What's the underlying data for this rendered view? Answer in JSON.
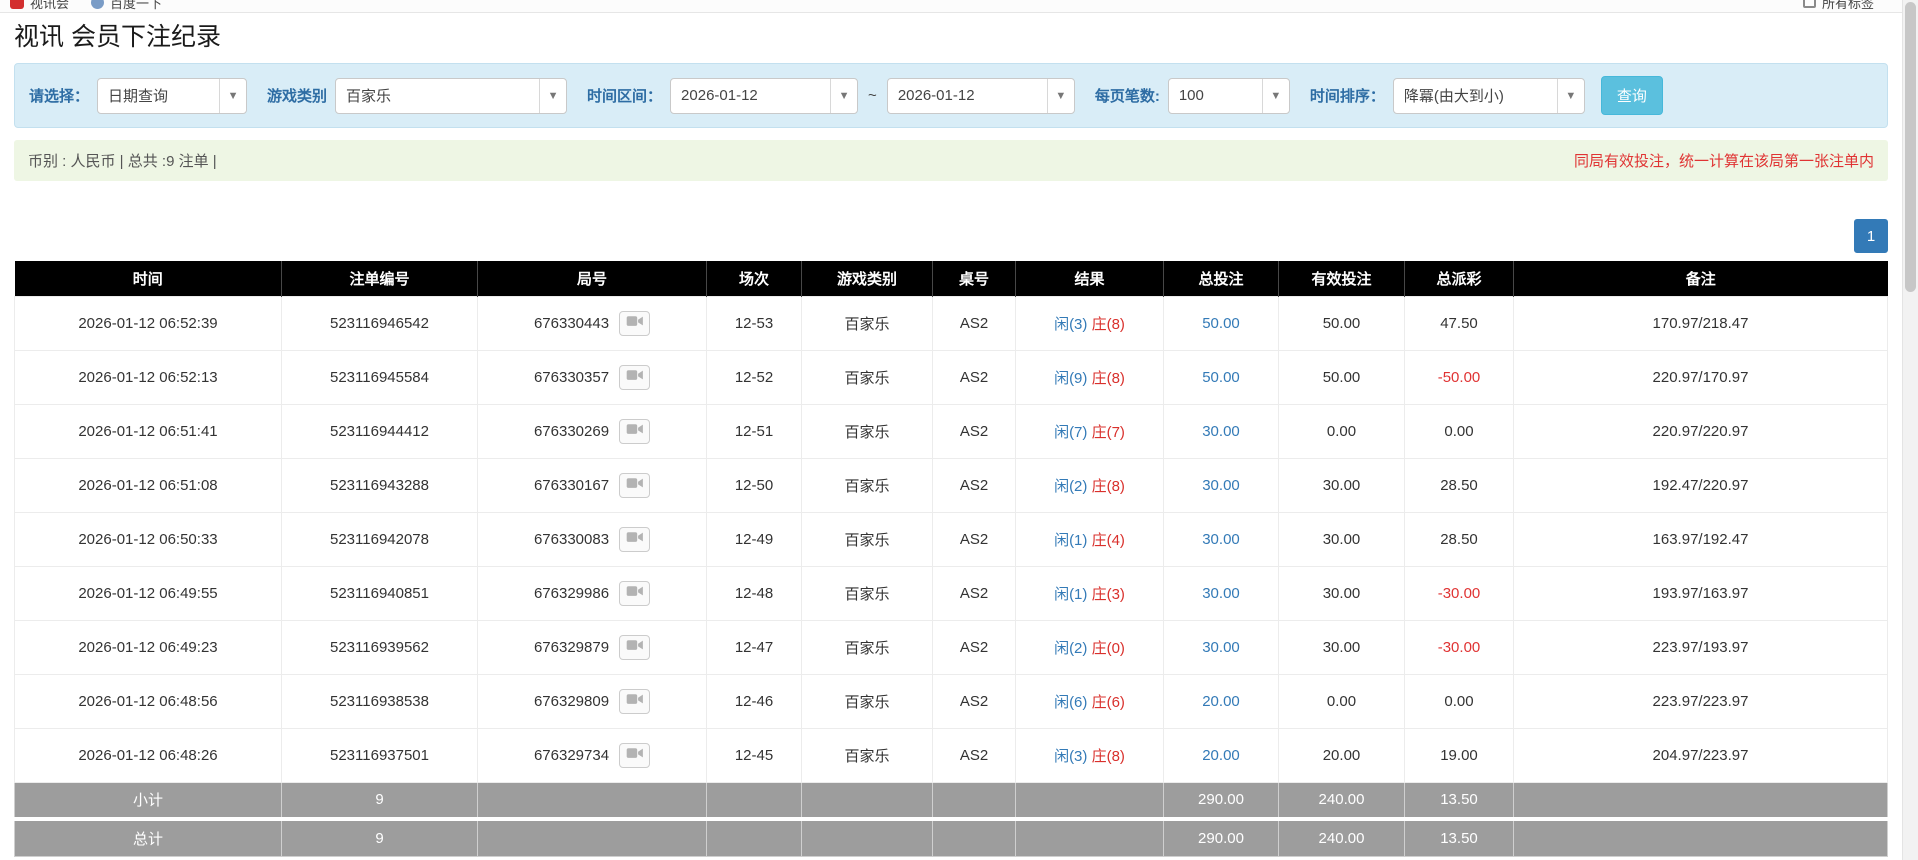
{
  "browser": {
    "bookmarks": [
      {
        "label": "视讯会"
      },
      {
        "label": "百度一下"
      }
    ],
    "all_tabs_label": "所有标签"
  },
  "page": {
    "title": "视讯 会员下注纪录"
  },
  "filters": {
    "select_label": "请选择：",
    "select_value": "日期查询",
    "game_type_label": "游戏类别",
    "game_type_value": "百家乐",
    "time_range_label": "时间区间：",
    "date_from": "2026-01-12",
    "range_separator": "~",
    "date_to": "2026-01-12",
    "page_size_label": "每页笔数:",
    "page_size_value": "100",
    "sort_label": "时间排序：",
    "sort_value": "降冪(由大到小)",
    "query_button": "查询"
  },
  "info_bar": {
    "summary": "币别 : 人民币 | 总共 :9 注单 |",
    "notice": "同局有效投注，统一计算在该局第一张注单内"
  },
  "pagination": {
    "current": "1"
  },
  "table": {
    "headers": [
      "时间",
      "注单编号",
      "局号",
      "场次",
      "游戏类别",
      "桌号",
      "结果",
      "总投注",
      "有效投注",
      "总派彩",
      "备注"
    ],
    "rows": [
      {
        "time": "2026-01-12 06:52:39",
        "bet_id": "523116946542",
        "round_id": "676330443",
        "session": "12-53",
        "game": "百家乐",
        "table_no": "AS2",
        "player": "闲(3)",
        "banker": "庄(8)",
        "total_bet": "50.00",
        "valid_bet": "50.00",
        "payout": "47.50",
        "note": "170.97/218.47"
      },
      {
        "time": "2026-01-12 06:52:13",
        "bet_id": "523116945584",
        "round_id": "676330357",
        "session": "12-52",
        "game": "百家乐",
        "table_no": "AS2",
        "player": "闲(9)",
        "banker": "庄(8)",
        "total_bet": "50.00",
        "valid_bet": "50.00",
        "payout": "-50.00",
        "note": "220.97/170.97"
      },
      {
        "time": "2026-01-12 06:51:41",
        "bet_id": "523116944412",
        "round_id": "676330269",
        "session": "12-51",
        "game": "百家乐",
        "table_no": "AS2",
        "player": "闲(7)",
        "banker": "庄(7)",
        "total_bet": "30.00",
        "valid_bet": "0.00",
        "payout": "0.00",
        "note": "220.97/220.97"
      },
      {
        "time": "2026-01-12 06:51:08",
        "bet_id": "523116943288",
        "round_id": "676330167",
        "session": "12-50",
        "game": "百家乐",
        "table_no": "AS2",
        "player": "闲(2)",
        "banker": "庄(8)",
        "total_bet": "30.00",
        "valid_bet": "30.00",
        "payout": "28.50",
        "note": "192.47/220.97"
      },
      {
        "time": "2026-01-12 06:50:33",
        "bet_id": "523116942078",
        "round_id": "676330083",
        "session": "12-49",
        "game": "百家乐",
        "table_no": "AS2",
        "player": "闲(1)",
        "banker": "庄(4)",
        "total_bet": "30.00",
        "valid_bet": "30.00",
        "payout": "28.50",
        "note": "163.97/192.47"
      },
      {
        "time": "2026-01-12 06:49:55",
        "bet_id": "523116940851",
        "round_id": "676329986",
        "session": "12-48",
        "game": "百家乐",
        "table_no": "AS2",
        "player": "闲(1)",
        "banker": "庄(3)",
        "total_bet": "30.00",
        "valid_bet": "30.00",
        "payout": "-30.00",
        "note": "193.97/163.97"
      },
      {
        "time": "2026-01-12 06:49:23",
        "bet_id": "523116939562",
        "round_id": "676329879",
        "session": "12-47",
        "game": "百家乐",
        "table_no": "AS2",
        "player": "闲(2)",
        "banker": "庄(0)",
        "total_bet": "30.00",
        "valid_bet": "30.00",
        "payout": "-30.00",
        "note": "223.97/193.97"
      },
      {
        "time": "2026-01-12 06:48:56",
        "bet_id": "523116938538",
        "round_id": "676329809",
        "session": "12-46",
        "game": "百家乐",
        "table_no": "AS2",
        "player": "闲(6)",
        "banker": "庄(6)",
        "total_bet": "20.00",
        "valid_bet": "0.00",
        "payout": "0.00",
        "note": "223.97/223.97"
      },
      {
        "time": "2026-01-12 06:48:26",
        "bet_id": "523116937501",
        "round_id": "676329734",
        "session": "12-45",
        "game": "百家乐",
        "table_no": "AS2",
        "player": "闲(3)",
        "banker": "庄(8)",
        "total_bet": "20.00",
        "valid_bet": "20.00",
        "payout": "19.00",
        "note": "204.97/223.97"
      }
    ],
    "subtotal": {
      "label": "小计",
      "count": "9",
      "total_bet": "290.00",
      "valid_bet": "240.00",
      "payout": "13.50"
    },
    "grand_total": {
      "label": "总计",
      "count": "9",
      "total_bet": "290.00",
      "valid_bet": "240.00",
      "payout": "13.50"
    }
  },
  "colors": {
    "accent_blue": "#337ab7",
    "query_button_bg": "#5bc0de",
    "filter_panel_bg": "#d9edf7",
    "info_bar_bg": "#eef6e4",
    "notice_red": "#e03333",
    "player_blue": "#337ab7",
    "banker_red": "#d9302c",
    "negative_red": "#e03333",
    "header_black": "#000000",
    "summary_gray": "#9d9d9d"
  }
}
